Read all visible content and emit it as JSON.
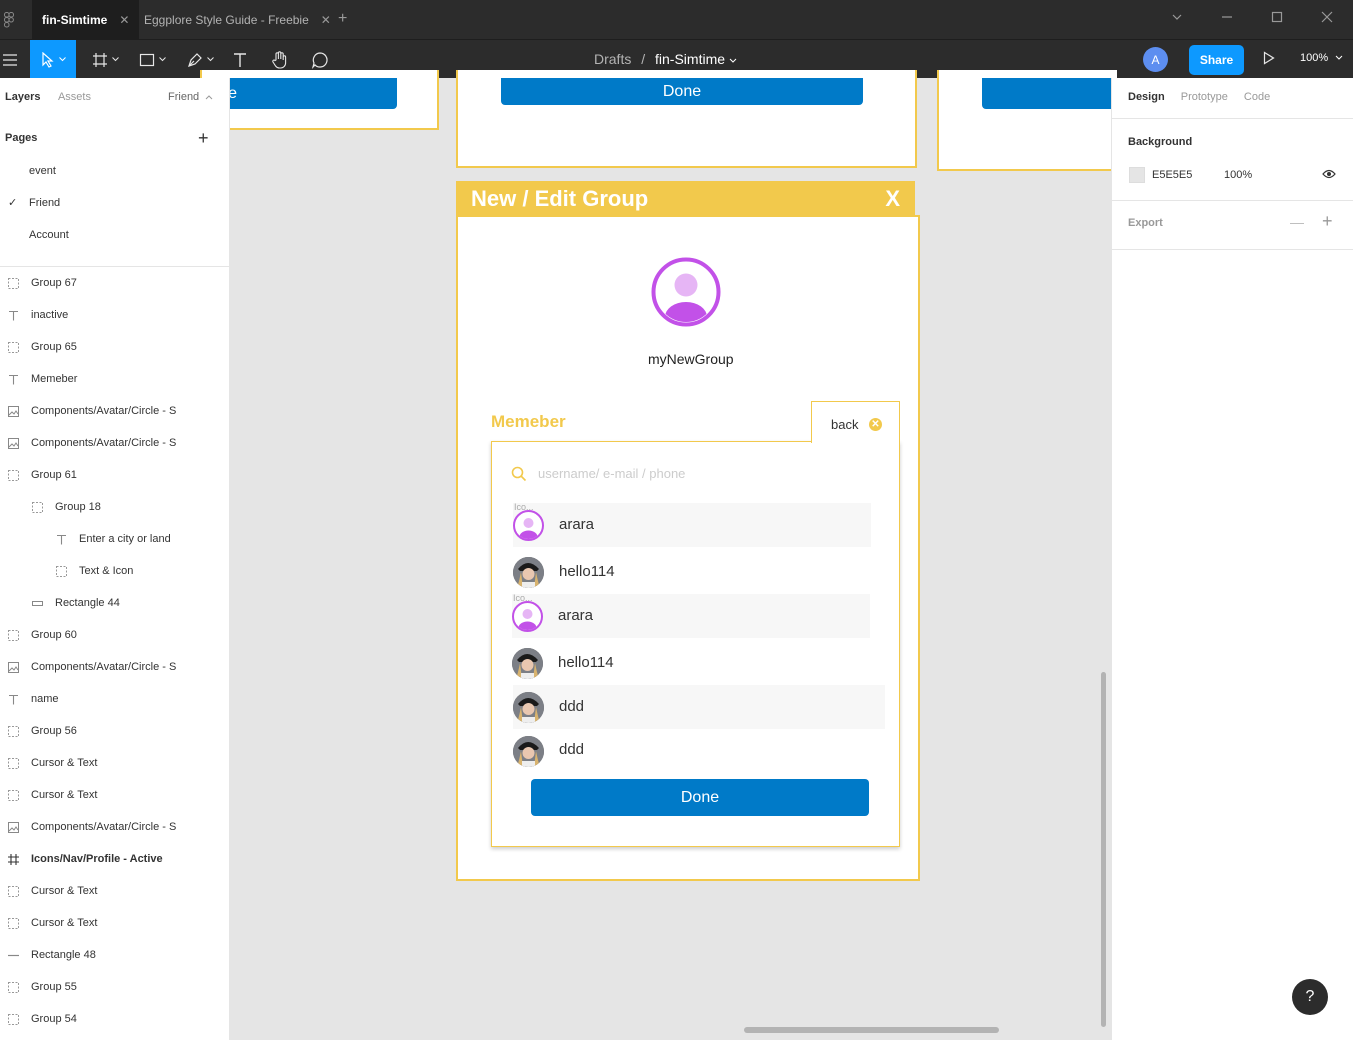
{
  "tabs": [
    {
      "label": "fin-Simtime"
    },
    {
      "label": "Eggplore Style Guide - Freebie"
    }
  ],
  "breadcrumb": {
    "folder": "Drafts",
    "sep": "/",
    "file": "fin-Simtime"
  },
  "toolbar": {
    "avatar_initial": "A",
    "share_label": "Share",
    "zoom": "100%"
  },
  "left_panel": {
    "tab_layers": "Layers",
    "tab_assets": "Assets",
    "current_page": "Friend",
    "pages_header": "Pages",
    "pages": [
      "event",
      "Friend",
      "Account"
    ],
    "layers": [
      {
        "label": "Group 67",
        "icon": "group-icon",
        "indent": 0
      },
      {
        "label": "inactive",
        "icon": "text-icon",
        "indent": 0
      },
      {
        "label": "Group 65",
        "icon": "group-icon",
        "indent": 0
      },
      {
        "label": "Memeber",
        "icon": "text-icon",
        "indent": 0
      },
      {
        "label": "Components/Avatar/Circle - S",
        "icon": "image-icon",
        "indent": 0
      },
      {
        "label": "Components/Avatar/Circle - S",
        "icon": "image-icon",
        "indent": 0
      },
      {
        "label": "Group 61",
        "icon": "group-icon",
        "indent": 0
      },
      {
        "label": "Group 18",
        "icon": "group-icon",
        "indent": 1
      },
      {
        "label": "Enter a city or land",
        "icon": "text-icon",
        "indent": 2
      },
      {
        "label": "Text & Icon",
        "icon": "group-icon",
        "indent": 2
      },
      {
        "label": "Rectangle 44",
        "icon": "rectangle-icon",
        "indent": 1
      },
      {
        "label": "Group 60",
        "icon": "group-icon",
        "indent": 0
      },
      {
        "label": "Components/Avatar/Circle - S",
        "icon": "image-icon",
        "indent": 0
      },
      {
        "label": "name",
        "icon": "text-icon",
        "indent": 0
      },
      {
        "label": "Group 56",
        "icon": "group-icon",
        "indent": 0
      },
      {
        "label": "Cursor & Text",
        "icon": "group-icon",
        "indent": 0
      },
      {
        "label": "Cursor & Text",
        "icon": "group-icon",
        "indent": 0
      },
      {
        "label": "Components/Avatar/Circle - S",
        "icon": "image-icon",
        "indent": 0
      },
      {
        "label": "Icons/Nav/Profile - Active",
        "icon": "frame-icon",
        "indent": 0,
        "bold": true
      },
      {
        "label": "Cursor & Text",
        "icon": "group-icon",
        "indent": 0
      },
      {
        "label": "Cursor & Text",
        "icon": "group-icon",
        "indent": 0
      },
      {
        "label": "Rectangle 48",
        "icon": "line-icon",
        "indent": 0
      },
      {
        "label": "Group 55",
        "icon": "group-icon",
        "indent": 0
      },
      {
        "label": "Group 54",
        "icon": "group-icon",
        "indent": 0
      }
    ]
  },
  "right_panel": {
    "tabs": [
      "Design",
      "Prototype",
      "Code"
    ],
    "background_header": "Background",
    "background_hex": "E5E5E5",
    "background_opacity": "100%",
    "export_header": "Export"
  },
  "canvas": {
    "top_left_btn_fragment": "e",
    "top_done_label": "Done",
    "frame_title": "New / Edit Group",
    "frame_close": "X",
    "group_name": "myNewGroup",
    "member_header": "Memeber",
    "back_label": "back",
    "search_placeholder": "username/ e-mail / phone",
    "icon_layer_label": "Ico...",
    "members": [
      {
        "name": "arara",
        "avatar": "purple"
      },
      {
        "name": "hello114",
        "avatar": "photo"
      },
      {
        "name": "arara",
        "avatar": "purple"
      },
      {
        "name": "hello114",
        "avatar": "photo"
      },
      {
        "name": "ddd",
        "avatar": "photo"
      },
      {
        "name": "ddd",
        "avatar": "photo"
      }
    ],
    "done_label": "Done"
  },
  "colors": {
    "accent_yellow": "#f2c94c",
    "button_blue": "#007ac8",
    "figma_blue": "#0d99ff",
    "avatar_purple": "#c251e8"
  },
  "help_label": "?"
}
